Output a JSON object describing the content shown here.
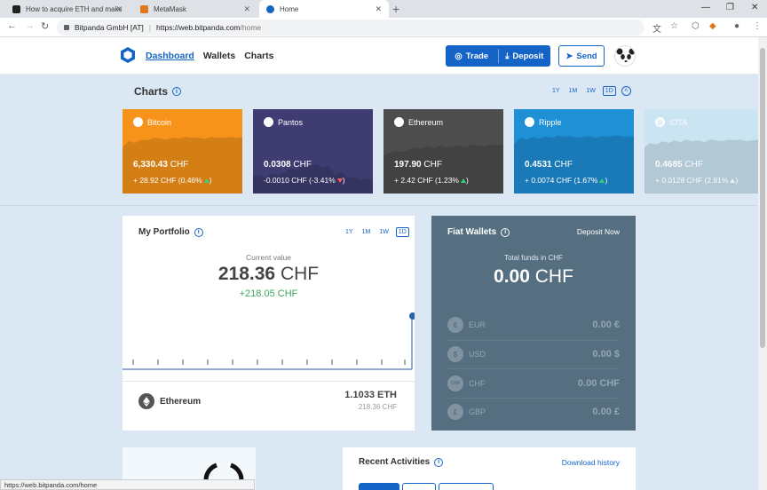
{
  "browser": {
    "tabs": [
      {
        "title": "How to acquire ETH and make a",
        "active": false
      },
      {
        "title": "MetaMask",
        "active": false
      },
      {
        "title": "Home",
        "active": true
      }
    ],
    "url_host": "Bitpanda GmbH [AT]",
    "url": "https://web.bitpanda.com/home",
    "url_prefix": "https://web.bitpanda.com",
    "url_path": "/home",
    "status_url": "https://web.bitpanda.com/home"
  },
  "header": {
    "nav": [
      "Dashboard",
      "Wallets",
      "Charts"
    ],
    "trade_label": "Trade",
    "deposit_label": "Deposit",
    "send_label": "Send"
  },
  "charts": {
    "title": "Charts",
    "ranges": [
      "1Y",
      "1M",
      "1W",
      "1D"
    ],
    "selected_range": "1D",
    "coins": [
      {
        "name": "Bitcoin",
        "icon": "bitcoin-icon",
        "glyph": "₿",
        "price": "6,330.43",
        "currency": "CHF",
        "change": "+ 28.92 CHF (0.46%",
        "direction": "up",
        "color": "#f7931a",
        "trend": [
          0.55,
          0.62,
          0.6,
          0.64,
          0.63,
          0.66,
          0.65,
          0.64,
          0.66,
          0.65,
          0.67,
          0.66,
          0.66,
          0.65,
          0.67,
          0.66,
          0.66,
          0.67,
          0.66,
          0.67
        ]
      },
      {
        "name": "Pantos",
        "icon": "pantos-icon",
        "glyph": "P",
        "price": "0.0308",
        "currency": "CHF",
        "change": "-0.0010 CHF (-3.41%",
        "direction": "down",
        "color": "#3e3c70",
        "trend": [
          0.2,
          0.22,
          0.18,
          0.24,
          0.21,
          0.25,
          0.3,
          0.28,
          0.34,
          0.32,
          0.35,
          0.3,
          0.33,
          0.22,
          0.26,
          0.18,
          0.2,
          0.16,
          0.18,
          0.15
        ]
      },
      {
        "name": "Ethereum",
        "icon": "ethereum-icon",
        "glyph": "◆",
        "price": "197.90",
        "currency": "CHF",
        "change": "+ 2.42 CHF (1.23%",
        "direction": "up",
        "color": "#4d4d4d",
        "trend": [
          0.45,
          0.48,
          0.5,
          0.49,
          0.52,
          0.55,
          0.53,
          0.56,
          0.54,
          0.57,
          0.55,
          0.56,
          0.57,
          0.55,
          0.58,
          0.57,
          0.56,
          0.58,
          0.57,
          0.58
        ]
      },
      {
        "name": "Ripple",
        "icon": "ripple-icon",
        "glyph": "✕",
        "price": "0.4531",
        "currency": "CHF",
        "change": "+ 0.0074 CHF (1.67%",
        "direction": "up",
        "color": "#1f8fd6",
        "trend": [
          0.58,
          0.66,
          0.64,
          0.67,
          0.65,
          0.68,
          0.66,
          0.69,
          0.67,
          0.68,
          0.66,
          0.67,
          0.68,
          0.66,
          0.68,
          0.67,
          0.69,
          0.68,
          0.67,
          0.68
        ]
      },
      {
        "name": "IOTA",
        "icon": "iota-icon",
        "glyph": "◎",
        "price": "0.4685",
        "currency": "CHF",
        "change": "+ 0.0128 CHF (2.81%",
        "direction": "up",
        "color": "#c9e4f2",
        "trend": [
          0.55,
          0.6,
          0.58,
          0.62,
          0.6,
          0.63,
          0.61,
          0.64,
          0.62,
          0.63,
          0.61,
          0.64,
          0.63,
          0.62,
          0.64,
          0.63,
          0.64,
          0.62,
          0.63,
          0.64
        ]
      }
    ]
  },
  "portfolio": {
    "title": "My Portfolio",
    "ranges": [
      "1Y",
      "1M",
      "1W",
      "1D"
    ],
    "selected_range": "1D",
    "current_label": "Current value",
    "value": "218.36",
    "currency": "CHF",
    "change": "+218.05 CHF",
    "asset_name": "Ethereum",
    "asset_amount": "1.1033 ETH",
    "asset_value": "218.36 CHF"
  },
  "fiat": {
    "title": "Fiat Wallets",
    "deposit_now": "Deposit Now",
    "total_label": "Total funds in CHF",
    "total_value": "0.00",
    "total_currency": "CHF",
    "wallets": [
      {
        "code": "EUR",
        "glyph": "€",
        "value": "0.00 €"
      },
      {
        "code": "USD",
        "glyph": "$",
        "value": "0.00 $"
      },
      {
        "code": "CHF",
        "glyph": "CHF",
        "value": "0.00 CHF"
      },
      {
        "code": "GBP",
        "glyph": "£",
        "value": "0.00 £"
      }
    ]
  },
  "activities": {
    "title": "Recent Activities",
    "download": "Download history"
  }
}
